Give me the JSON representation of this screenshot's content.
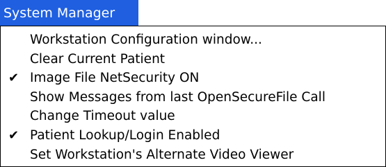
{
  "menu": {
    "title": "System Manager",
    "items": [
      {
        "label": "Workstation Configuration window...",
        "checked": false
      },
      {
        "label": "Clear Current Patient",
        "checked": false
      },
      {
        "label": "Image File NetSecurity ON",
        "checked": true
      },
      {
        "label": "Show Messages from last OpenSecureFile Call",
        "checked": false
      },
      {
        "label": "Change Timeout value",
        "checked": false
      },
      {
        "label": "Patient Lookup/Login Enabled",
        "checked": true
      },
      {
        "label": "Set Workstation's Alternate Video Viewer",
        "checked": false
      }
    ],
    "check_glyph": "✔"
  }
}
